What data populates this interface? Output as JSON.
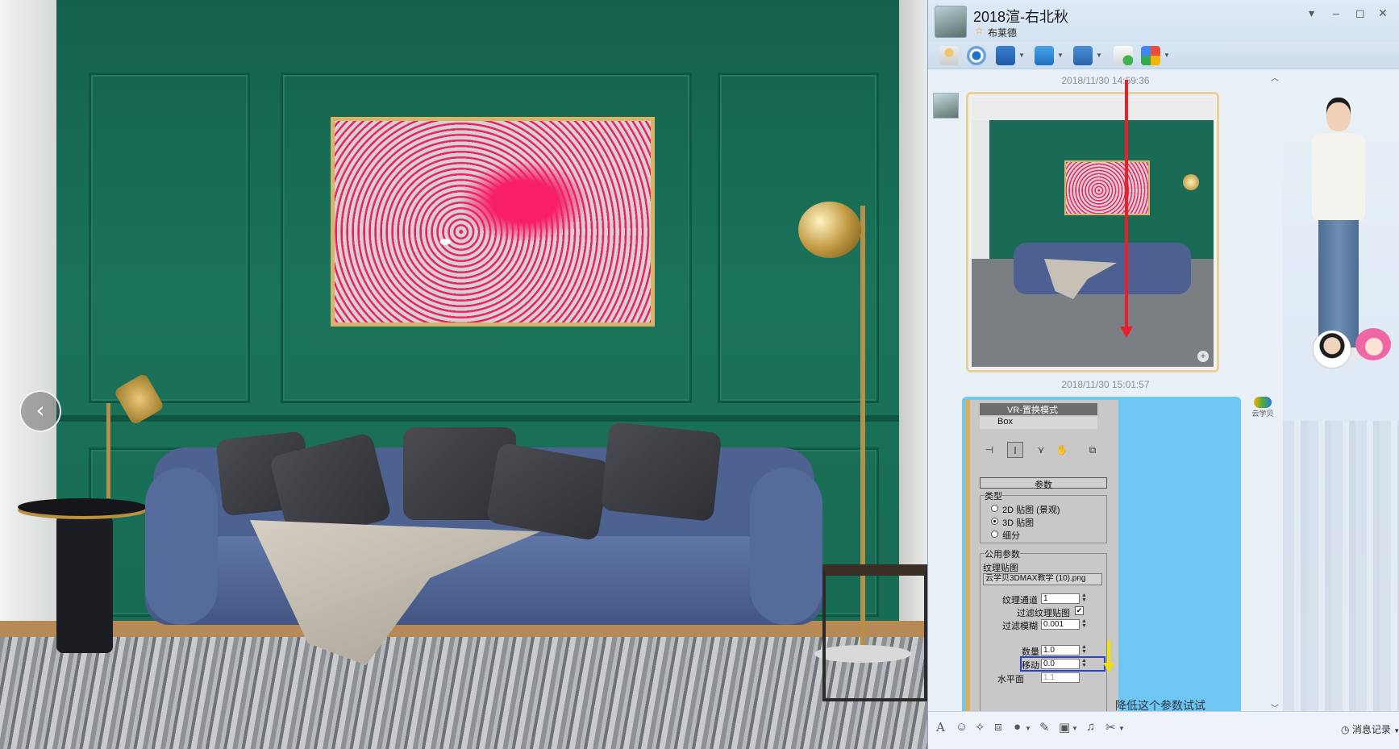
{
  "viewer": {
    "prev_glyph": "‹"
  },
  "chat": {
    "title": "2018渲-右北秋",
    "subtitle": "布莱德",
    "window_buttons": [
      "▾",
      "–",
      "◻",
      "✕"
    ],
    "toolbar_icons": [
      "microphone-icon",
      "webcam-icon",
      "screen-share-icon",
      "file-transfer-icon",
      "remote-desktop-icon",
      "new-discussion-icon",
      "apps-grid-icon"
    ],
    "messages": [
      {
        "timestamp": "2018/11/30 14:59:36",
        "type": "image"
      },
      {
        "timestamp": "2018/11/30 15:01:57",
        "type": "screenshot"
      }
    ],
    "max_panel": {
      "modifier_title": "VR-置换模式",
      "object_name": "Box",
      "rollout_title": "参数",
      "rollout_sign": "-",
      "group_type": {
        "label": "类型",
        "options": [
          "2D 贴图 (景观)",
          "3D 贴图",
          "细分"
        ],
        "selected": "3D 贴图"
      },
      "group_common": {
        "label": "公用参数",
        "texmap_label": "纹理贴图",
        "texmap_value": "云学贝3DMAX教学 (10).png",
        "channel_label": "纹理通道",
        "channel_value": "1",
        "filter_label": "过滤纹理贴图",
        "filter_checked": "✔",
        "blur_label": "过滤模糊",
        "blur_value": "0.001",
        "amount_label": "数量",
        "amount_value": "1.0",
        "shift_label": "移动",
        "shift_value": "0.0",
        "water_label": "水平面",
        "water_value": "1.1"
      },
      "side_note": "降低这个参数试试"
    },
    "brand_label": "云学贝",
    "input_bar": {
      "font_glyph": "A",
      "emoji_glyph": "☺",
      "history_label": "消息记录"
    },
    "accent_colors": {
      "red_arrow": "#e8202a",
      "yellow_arrow": "#f0e010",
      "highlight_box": "#2a44c9"
    }
  }
}
